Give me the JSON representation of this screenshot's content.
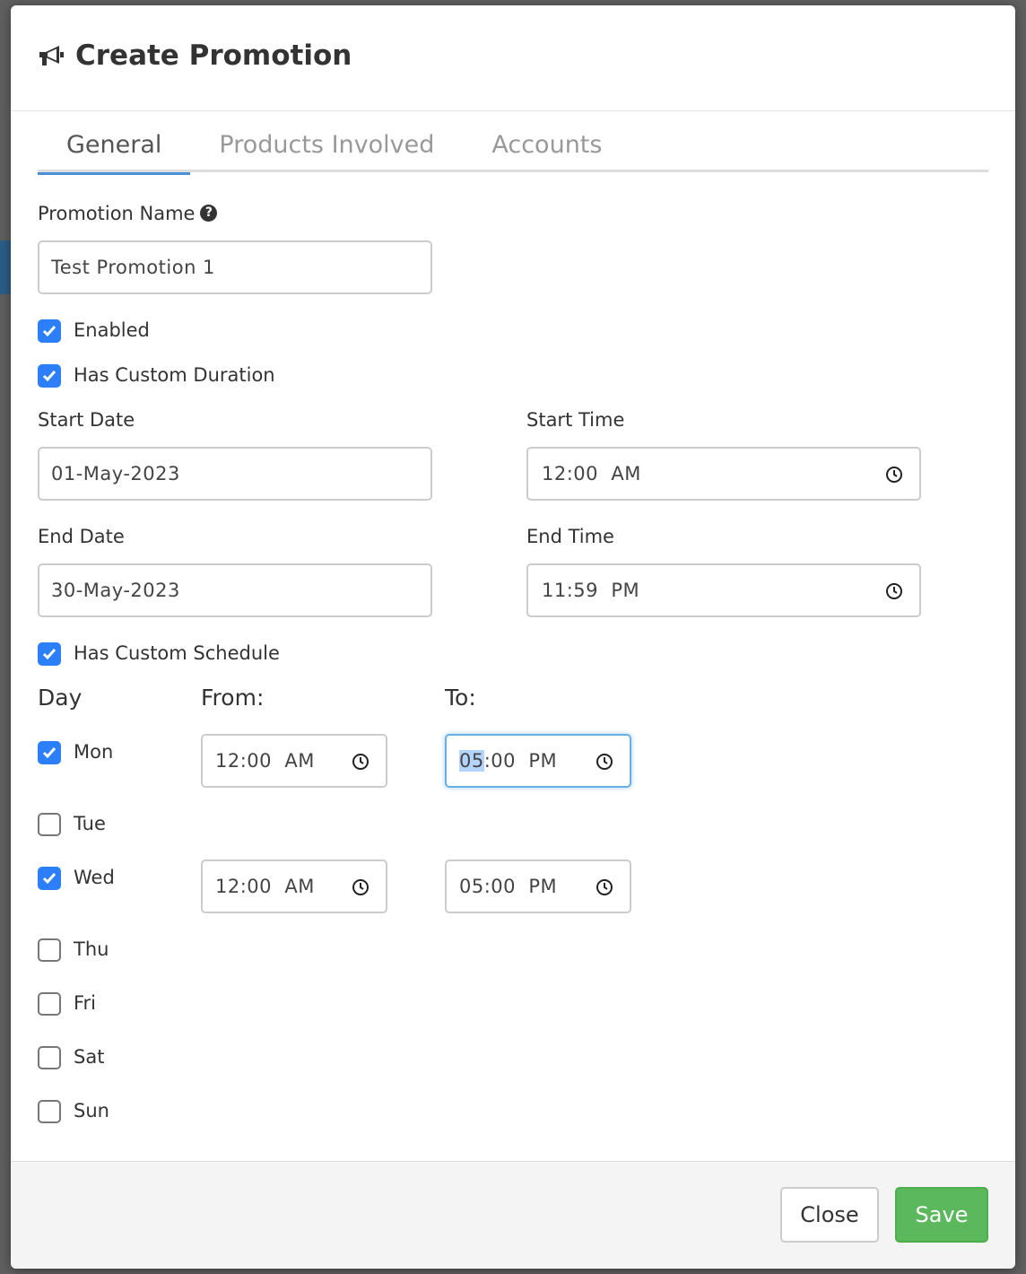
{
  "modal": {
    "title": "Create Promotion",
    "icon": "bullhorn-icon"
  },
  "tabs": [
    {
      "label": "General",
      "active": true
    },
    {
      "label": "Products Involved",
      "active": false
    },
    {
      "label": "Accounts",
      "active": false
    }
  ],
  "form": {
    "promotion_name_label": "Promotion Name",
    "promotion_name_value": "Test Promotion 1",
    "enabled_label": "Enabled",
    "enabled_checked": true,
    "custom_duration_label": "Has Custom Duration",
    "custom_duration_checked": true,
    "start_date_label": "Start Date",
    "start_date_value": "01-May-2023",
    "start_time_label": "Start Time",
    "start_time_value": "12:00  AM",
    "end_date_label": "End Date",
    "end_date_value": "30-May-2023",
    "end_time_label": "End Time",
    "end_time_value": "11:59  PM",
    "custom_schedule_label": "Has Custom Schedule",
    "custom_schedule_checked": true
  },
  "schedule": {
    "col_day": "Day",
    "col_from": "From:",
    "col_to": "To:",
    "days": [
      {
        "label": "Mon",
        "checked": true,
        "from": "12:00  AM",
        "to_hour": "05",
        "to_rest": ":00  PM"
      },
      {
        "label": "Tue",
        "checked": false
      },
      {
        "label": "Wed",
        "checked": true,
        "from": "12:00  AM",
        "to": "05:00  PM"
      },
      {
        "label": "Thu",
        "checked": false
      },
      {
        "label": "Fri",
        "checked": false
      },
      {
        "label": "Sat",
        "checked": false
      },
      {
        "label": "Sun",
        "checked": false
      }
    ]
  },
  "footer": {
    "close_label": "Close",
    "save_label": "Save"
  },
  "colors": {
    "accent": "#2d7ff9",
    "tab_underline": "#4a90d9",
    "save": "#5cb85c"
  }
}
